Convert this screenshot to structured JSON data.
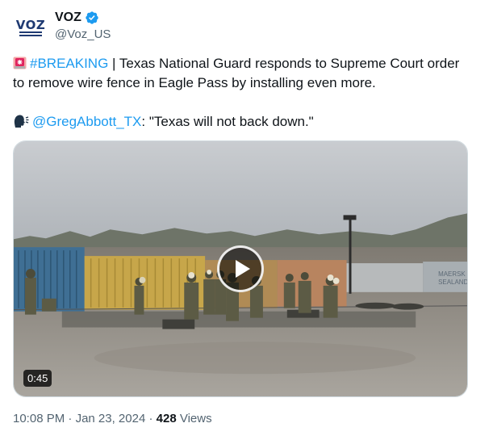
{
  "author": {
    "avatar_text": "VOZ",
    "display_name": "VOZ",
    "handle": "@Voz_US",
    "verified_color": "#1d9bf0"
  },
  "tweet": {
    "hashtag": "#BREAKING",
    "text_line1": " | Texas National Guard responds to Supreme Court order to remove wire fence in Eagle Pass by installing even more.",
    "mention": "@GregAbbott_TX",
    "quote": ": \"Texas will not back down.\"",
    "icons": [
      "police-siren-icon",
      "speaking-head-icon"
    ]
  },
  "media": {
    "duration": "0:45",
    "play_icon": "play-icon",
    "container_label": "MAERSK SEALAND"
  },
  "meta": {
    "time": "10:08 PM",
    "separator": "·",
    "date": "Jan 23, 2024",
    "views_count": "428",
    "views_label": "Views"
  },
  "colors": {
    "link": "#1d9bf0",
    "secondary_text": "#536471",
    "primary_text": "#0f1419"
  }
}
